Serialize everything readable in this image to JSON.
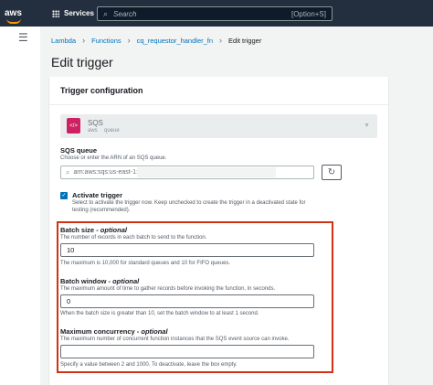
{
  "header": {
    "logo_text": "aws",
    "services_label": "Services",
    "search_placeholder": "Search",
    "search_shortcut": "[Option+S]"
  },
  "breadcrumb": {
    "items": [
      "Lambda",
      "Functions",
      "cq_requestor_handler_fn"
    ],
    "current": "Edit trigger"
  },
  "page_title": "Edit trigger",
  "panel": {
    "title": "Trigger configuration",
    "source": {
      "name": "SQS",
      "tag1": "aws",
      "tag2": "queue"
    },
    "sqs_queue": {
      "label": "SQS queue",
      "description": "Choose or enter the ARN of an SQS queue.",
      "value": "arn:aws:sqs:us-east-1:"
    },
    "activate": {
      "label": "Activate trigger",
      "description_line1": "Select to activate the trigger now. Keep unchecked to create the trigger in a deactivated state for",
      "description_line2": "testing (recommended).",
      "checked": true
    },
    "batch_size": {
      "label": "Batch size",
      "optional": "optional",
      "description": "The number of records in each batch to send to the function.",
      "value": "10",
      "hint": "The maximum is 10,000 for standard queues and 10 for FIFO queues."
    },
    "batch_window": {
      "label": "Batch window",
      "optional": "optional",
      "description": "The maximum amount of time to gather records before invoking the function, in seconds.",
      "value": "0",
      "hint": "When the batch size is greater than 10, set the batch window to at least 1 second."
    },
    "max_concurrency": {
      "label": "Maximum concurrency",
      "optional": "optional",
      "description": "The maximum number of concurrent function instances that the SQS event source can invoke.",
      "value": "",
      "hint": "Specify a value between 2 and 1000. To deactivate, leave the box empty."
    }
  },
  "colors": {
    "topbar": "#232f3e",
    "link": "#0073bb",
    "highlight": "#d13212",
    "sqs": "#cc2264"
  }
}
